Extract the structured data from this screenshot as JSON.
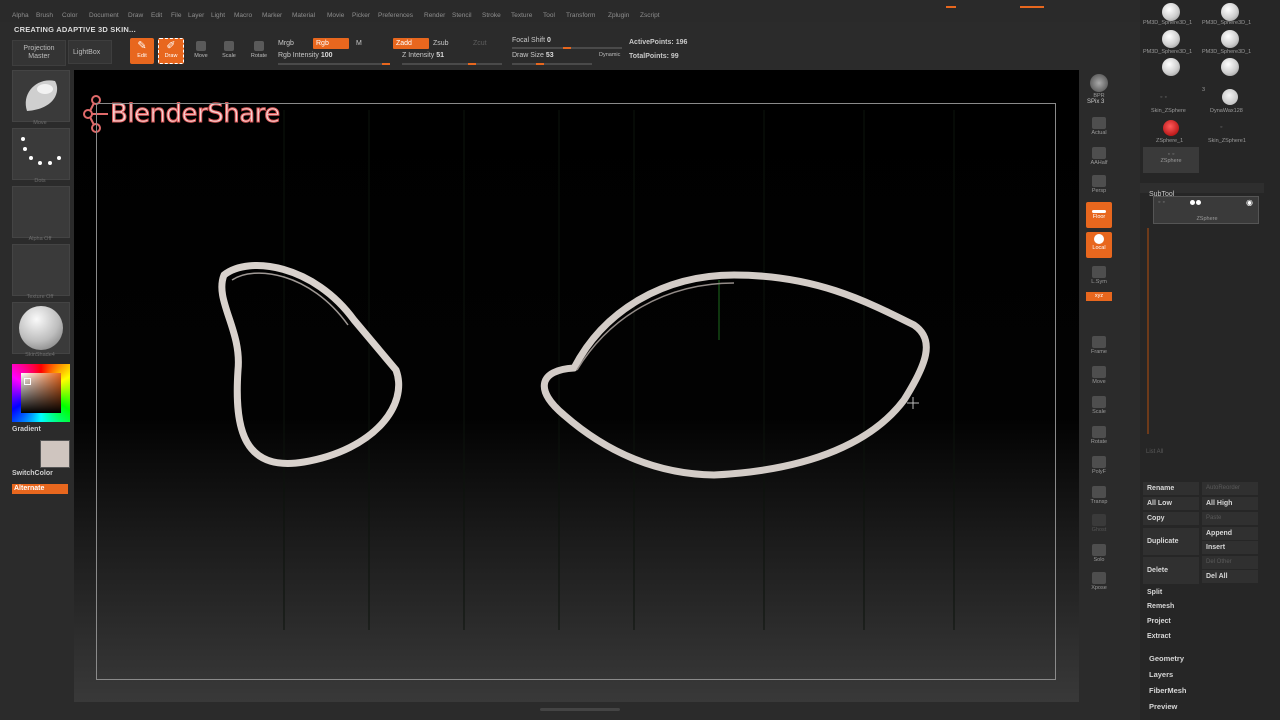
{
  "menu": [
    "Alpha",
    "Brush",
    "Color",
    "Document",
    "Draw",
    "Edit",
    "File",
    "Layer",
    "Light",
    "Macro",
    "Marker",
    "Material",
    "Movie",
    "Picker",
    "Preferences",
    "Render",
    "Stencil",
    "Stroke",
    "Texture",
    "Tool",
    "Transform",
    "Zplugin",
    "Zscript"
  ],
  "status_text": "CREATING ADAPTIVE 3D SKIN...",
  "toolbar": {
    "projection_master": "Projection Master",
    "lightbox": "LightBox",
    "edit": "Edit",
    "draw": "Draw",
    "move": "Move",
    "scale": "Scale",
    "rotate": "Rotate",
    "mrgb": "Mrgb",
    "rgb": "Rgb",
    "m": "M",
    "rgb_intensity_label": "Rgb Intensity",
    "rgb_intensity_value": "100",
    "zadd": "Zadd",
    "zsub": "Zsub",
    "zcut": "Zcut",
    "z_intensity_label": "Z Intensity",
    "z_intensity_value": "51",
    "focal_shift_label": "Focal Shift",
    "focal_shift_value": "0",
    "draw_size_label": "Draw Size",
    "draw_size_value": "53",
    "dynamic": "Dynamic",
    "active_points_label": "ActivePoints:",
    "active_points_value": "196",
    "total_points_label": "TotalPoints:",
    "total_points_value": "99"
  },
  "left_tray": {
    "move": "Move",
    "dots": "Dots",
    "alpha_off": "Alpha Off",
    "texture_off": "Texture Off",
    "material": "SkinShade4",
    "gradient": "Gradient",
    "switch_color": "SwitchColor",
    "alternate": "Alternate"
  },
  "watermark": "BlenderShare",
  "right_shelf": [
    "BPR",
    "SPix",
    "3",
    "Actual",
    "AAHalf",
    "Persp",
    "Floor",
    "Local",
    "L.Sym",
    "xyz",
    "Frame",
    "Move",
    "Scale",
    "Rotate",
    "PolyF",
    "Transp",
    "Ghost",
    "Solo",
    "Xpose"
  ],
  "tool_palette": {
    "items": [
      "PM3D_Sphere3D_1",
      "PM3D_Sphere3D_1",
      "PM3D_Sphere3D_1",
      "PM3D_Sphere3D_1",
      "Skin_ZSphere",
      "DynaWax128",
      "ZSphere_1",
      "Skin_ZSphere1",
      "ZSphere"
    ],
    "count_badge": "3"
  },
  "subtool": {
    "title": "SubTool",
    "item_label": "ZSphere",
    "list_all": "List All",
    "rename": "Rename",
    "auto_reorder": "AutoReorder",
    "all_low": "All Low",
    "all_high": "All High",
    "copy": "Copy",
    "paste": "Paste",
    "duplicate": "Duplicate",
    "append": "Append",
    "insert": "Insert",
    "delete": "Delete",
    "del_other": "Del Other",
    "del_all": "Del All",
    "split": "Split",
    "remesh": "Remesh",
    "project": "Project",
    "extract": "Extract"
  },
  "sections": [
    "Geometry",
    "Layers",
    "FiberMesh",
    "Preview"
  ],
  "colors": {
    "accent": "#e8671e",
    "background": "#2b2b2b",
    "panel": "#262626"
  }
}
